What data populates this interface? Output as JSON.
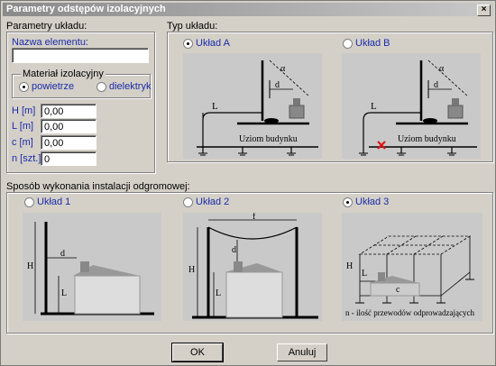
{
  "window": {
    "title": "Parametry odstępów izolacyjnych",
    "close": "×"
  },
  "params": {
    "group_label": "Parametry układu:",
    "element_name_label": "Nazwa elementu:",
    "element_name_value": "",
    "material_group_label": "Materiał izolacyjny",
    "material_air": "powietrze",
    "material_dielectric": "dielektryk",
    "material_selected": "powietrze",
    "fields": [
      {
        "label": "H [m]",
        "value": "0,00"
      },
      {
        "label": "L [m]",
        "value": "0,00"
      },
      {
        "label": "c [m]",
        "value": "0,00"
      },
      {
        "label": "n [szt.]",
        "value": "0"
      }
    ]
  },
  "layout_type": {
    "group_label": "Typ układu:",
    "options": [
      {
        "label": "Układ A",
        "selected": true,
        "caption": "Uziom budynku",
        "l": "L",
        "d": "d",
        "alpha": "α"
      },
      {
        "label": "Układ B",
        "selected": false,
        "caption": "Uziom budynku",
        "l": "L",
        "d": "d",
        "alpha": "α"
      }
    ]
  },
  "install": {
    "group_label": "Sposób wykonania instalacji odgromowej:",
    "options": [
      {
        "label": "Układ 1",
        "selected": false,
        "h": "H",
        "d": "d",
        "l": "L"
      },
      {
        "label": "Układ 2",
        "selected": false,
        "h": "H",
        "d": "d",
        "l": "L",
        "f": "f"
      },
      {
        "label": "Układ 3",
        "selected": true,
        "h": "H",
        "l": "L",
        "c": "c",
        "caption": "n - ilość przewodów odprowadzających"
      }
    ]
  },
  "buttons": {
    "ok": "OK",
    "cancel": "Anuluj"
  }
}
